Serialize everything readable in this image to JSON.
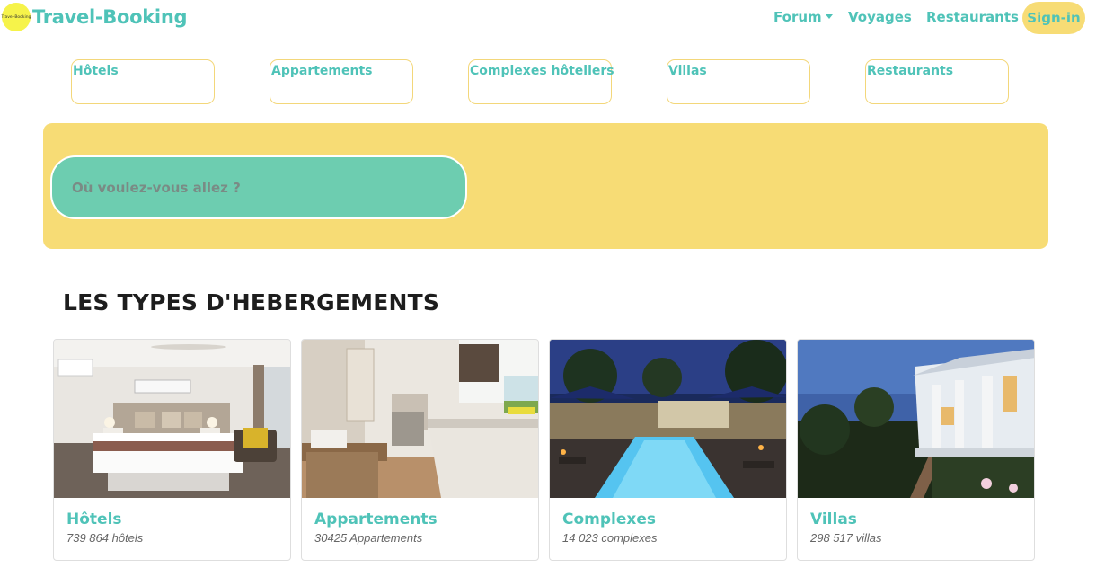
{
  "navbar": {
    "logo_text": "Travel-Booking",
    "brand": "Travel-Booking",
    "items": {
      "forum": "Forum",
      "voyages": "Voyages",
      "restaurants": "Restaurants"
    },
    "signin": "Sign-in"
  },
  "categories": [
    "Hôtels",
    "Appartements",
    "Complexes hôteliers",
    "Villas",
    "Restaurants"
  ],
  "search": {
    "placeholder": "Où voulez-vous allez ?"
  },
  "section": {
    "title": "LES TYPES D'HEBERGEMENTS"
  },
  "cards": [
    {
      "title": "Hôtels",
      "subtitle": "739 864 hôtels"
    },
    {
      "title": "Appartements",
      "subtitle": "30425 Appartements"
    },
    {
      "title": "Complexes",
      "subtitle": "14 023 complexes"
    },
    {
      "title": "Villas",
      "subtitle": "298 517 villas"
    }
  ],
  "colors": {
    "accent": "#4fc3b8",
    "banner": "#f7dc75",
    "search_field": "#6dcdb0",
    "logo_badge": "#f6f34a"
  }
}
